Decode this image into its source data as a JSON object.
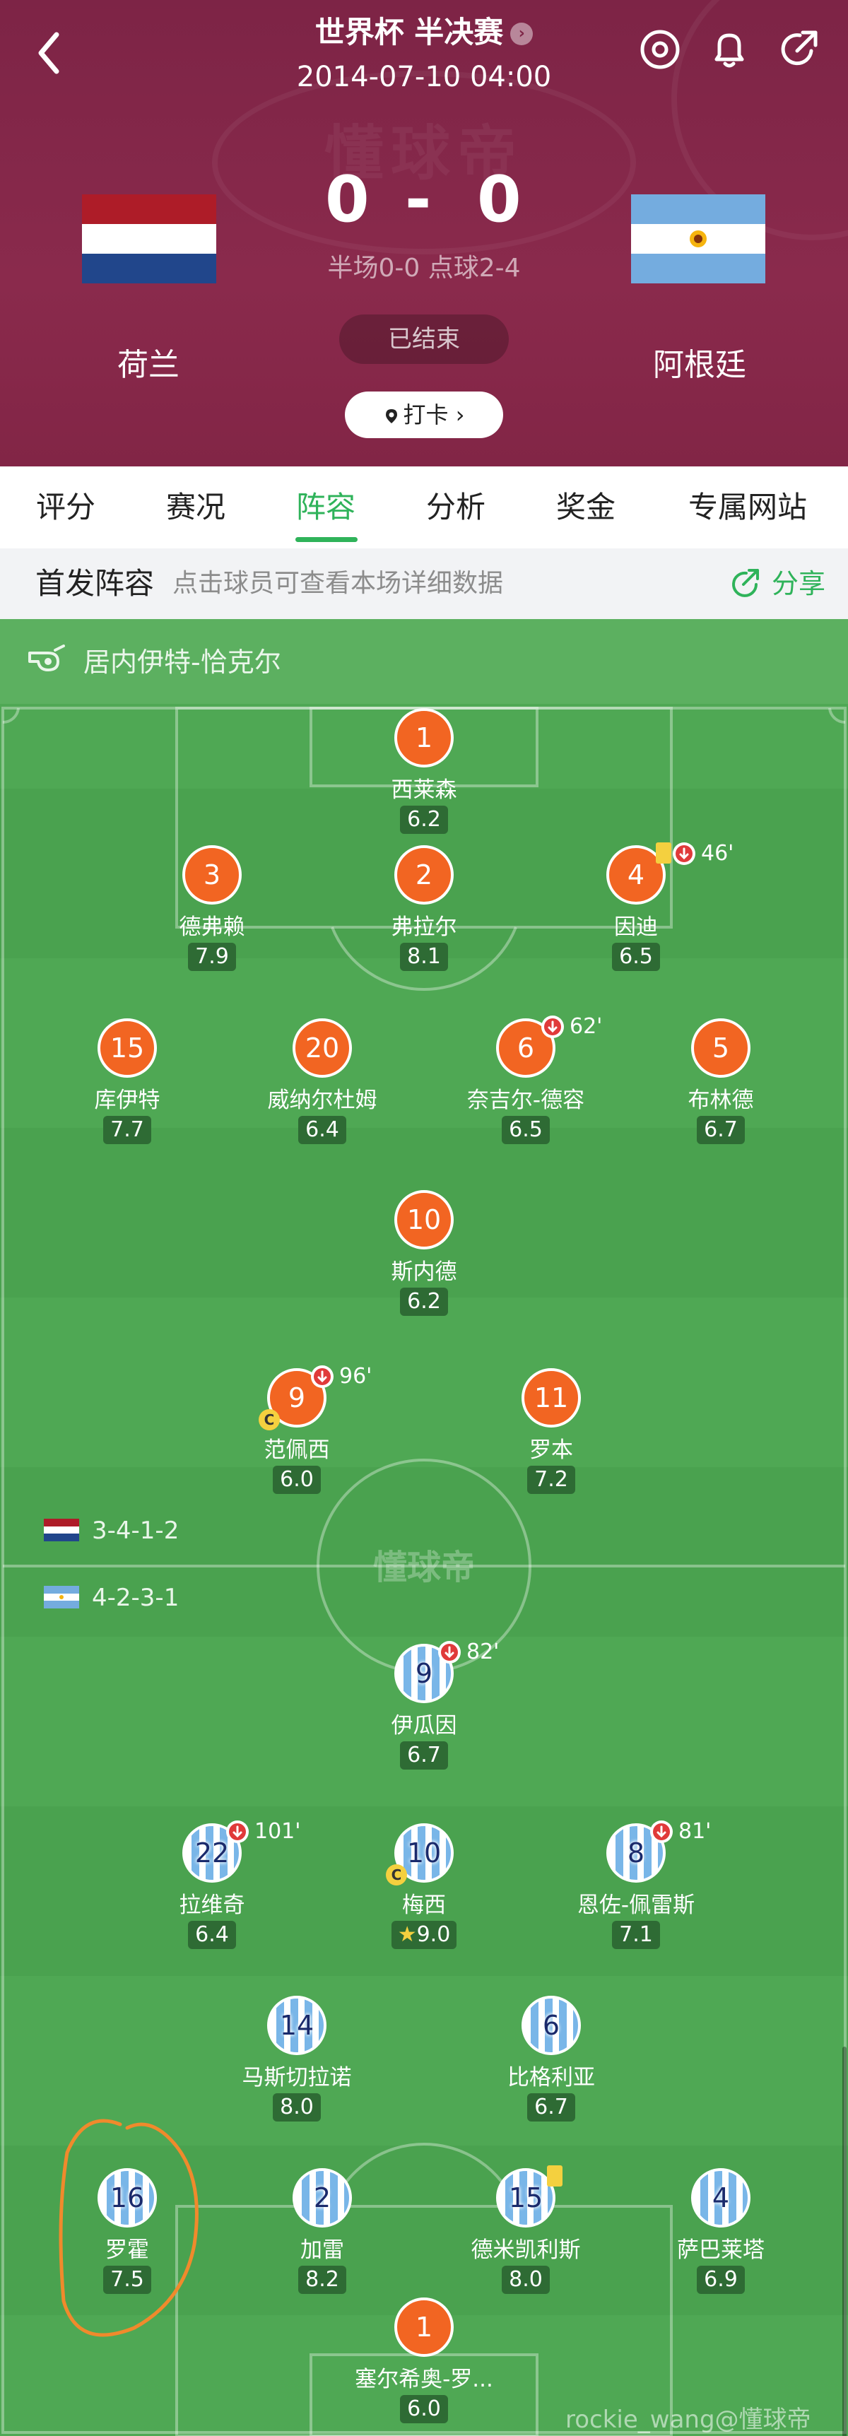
{
  "header": {
    "title": "世界杯 半决赛",
    "datetime": "2014-07-10 04:00",
    "watermark": "懂球帝",
    "home": {
      "name": "荷兰",
      "score": "0"
    },
    "away": {
      "name": "阿根廷",
      "score": "0"
    },
    "score_separator": "-",
    "score_detail": "半场0-0 点球2-4",
    "status": "已结束",
    "checkin_label": "打卡",
    "icons": [
      "back-icon",
      "target-icon",
      "bell-icon",
      "share-arrow-icon"
    ]
  },
  "tabs": [
    "评分",
    "赛况",
    "阵容",
    "分析",
    "奖金",
    "专属网站"
  ],
  "active_tab": "阵容",
  "lineup": {
    "title": "首发阵容",
    "hint": "点击球员可查看本场详细数据",
    "share": "分享",
    "referee": "居内伊特-恰克尔",
    "home_formation": "3-4-1-2",
    "away_formation": "4-2-3-1",
    "pitch_watermark": "懂球帝"
  },
  "home_players": [
    {
      "number": "1",
      "name": "西莱森",
      "rating": "6.2"
    },
    {
      "number": "3",
      "name": "德弗赖",
      "rating": "7.9"
    },
    {
      "number": "2",
      "name": "弗拉尔",
      "rating": "8.1"
    },
    {
      "number": "4",
      "name": "因迪",
      "rating": "6.5",
      "sub_time": "46'",
      "yellow": true
    },
    {
      "number": "15",
      "name": "库伊特",
      "rating": "7.7"
    },
    {
      "number": "20",
      "name": "威纳尔杜姆",
      "rating": "6.4"
    },
    {
      "number": "6",
      "name": "奈吉尔-德容",
      "rating": "6.5",
      "sub_time": "62'"
    },
    {
      "number": "5",
      "name": "布林德",
      "rating": "6.7"
    },
    {
      "number": "10",
      "name": "斯内德",
      "rating": "6.2"
    },
    {
      "number": "9",
      "name": "范佩西",
      "rating": "6.0",
      "sub_time": "96'",
      "captain": "C"
    },
    {
      "number": "11",
      "name": "罗本",
      "rating": "7.2"
    }
  ],
  "away_players": [
    {
      "number": "9",
      "name": "伊瓜因",
      "rating": "6.7",
      "sub_time": "82'"
    },
    {
      "number": "22",
      "name": "拉维奇",
      "rating": "6.4",
      "sub_time": "101'"
    },
    {
      "number": "10",
      "name": "梅西",
      "rating": "9.0",
      "captain": "C",
      "star": "★"
    },
    {
      "number": "8",
      "name": "恩佐-佩雷斯",
      "rating": "7.1",
      "sub_time": "81'"
    },
    {
      "number": "14",
      "name": "马斯切拉诺",
      "rating": "8.0"
    },
    {
      "number": "6",
      "name": "比格利亚",
      "rating": "6.7"
    },
    {
      "number": "16",
      "name": "罗霍",
      "rating": "7.5"
    },
    {
      "number": "2",
      "name": "加雷",
      "rating": "8.2"
    },
    {
      "number": "15",
      "name": "德米凯利斯",
      "rating": "8.0",
      "yellow": true
    },
    {
      "number": "4",
      "name": "萨巴莱塔",
      "rating": "6.9"
    },
    {
      "number": "1",
      "name": "塞尔希奥-罗...",
      "rating": "6.0"
    }
  ],
  "footer_watermark": "rockie_wang@懂球帝",
  "colors": {
    "header_bg": "#7d2446",
    "accent": "#2fb35a",
    "home_kit": "#f26522",
    "away_kit": "#79b6e8",
    "pitch": "#4fa854"
  }
}
